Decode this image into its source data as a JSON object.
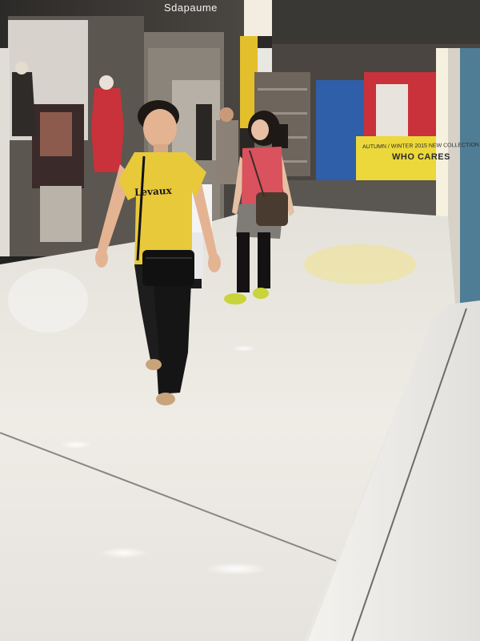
{
  "scene": {
    "store_sign": "Sdapaume",
    "banner_subtitle": "AUTUMN / WINTER 2015 NEW COLLECTION",
    "banner_title": "WHO CARES",
    "shirt_print": "Levaux"
  },
  "colors": {
    "floor": "#ece9e3",
    "shirt_yellow": "#e8c93a",
    "pink_top": "#d9525e",
    "window_red": "#c9323a",
    "window_blue": "#2f5fa8",
    "banner_yellow": "#ecd83a"
  }
}
